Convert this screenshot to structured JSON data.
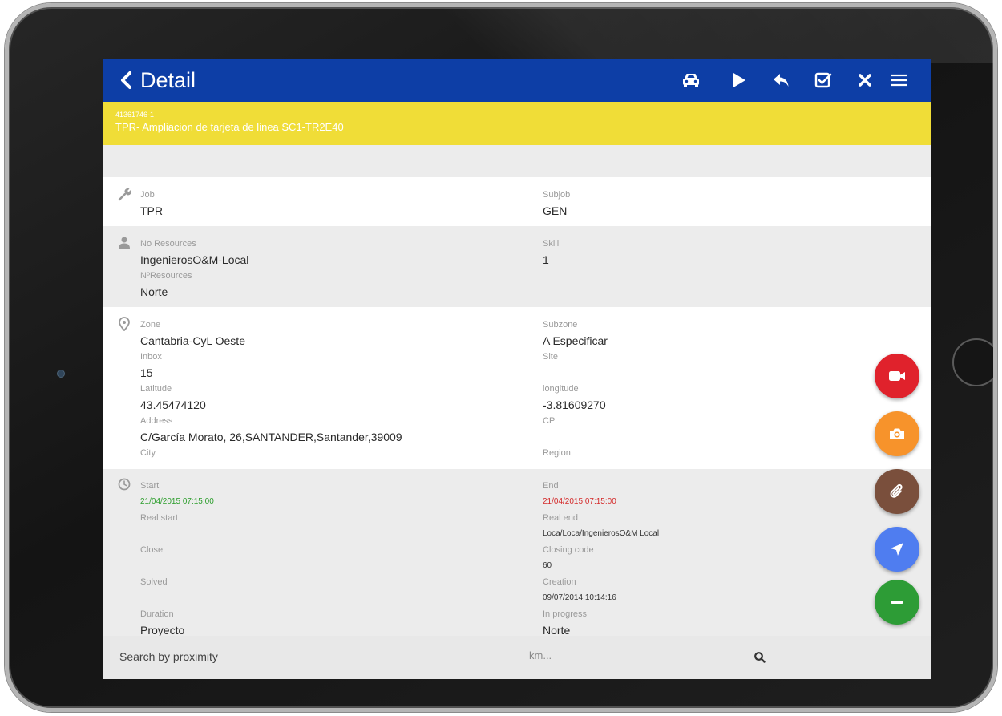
{
  "header": {
    "title": "Detail"
  },
  "banner": {
    "code": "41361746-1",
    "title": "TPR- Ampliacion de tarjeta de linea SC1-TR2E40"
  },
  "job_section": {
    "job_label": "Job",
    "job_value": "TPR",
    "subjob_label": "Subjob",
    "subjob_value": "GEN"
  },
  "resources_section": {
    "no_resources_label": "No Resources",
    "no_resources_value": "IngenierosO&M-Local",
    "n_resources_label": "NºResources",
    "n_resources_value": "Norte",
    "skill_label": "Skill",
    "skill_value": "1"
  },
  "location_section": {
    "zone_label": "Zone",
    "zone_value": "Cantabria-CyL Oeste",
    "subzone_label": "Subzone",
    "subzone_value": "A Especificar",
    "inbox_label": "Inbox",
    "inbox_value": "15",
    "site_label": "Site",
    "latitude_label": "Latitude",
    "latitude_value": "43.45474120",
    "longitude_label": "longitude",
    "longitude_value": "-3.81609270",
    "address_label": "Address",
    "address_value": "C/García Morato, 26,SANTANDER,Santander,39009",
    "cp_label": "CP",
    "city_label": "City",
    "region_label": "Region"
  },
  "time_section": {
    "start_label": "Start",
    "start_value": "21/04/2015 07:15:00",
    "end_label": "End",
    "end_value": "21/04/2015 07:15:00",
    "real_start_label": "Real start",
    "real_end_label": "Real end",
    "real_end_value": "Loca/Loca/IngenierosO&M Local",
    "close_label": "Close",
    "closing_code_label": "Closing code",
    "closing_code_value": "60",
    "solved_label": "Solved",
    "creation_label": "Creation",
    "creation_value": "09/07/2014 10:14:16",
    "duration_label": "Duration",
    "duration_value": "Proyecto",
    "in_progress_label": "In progress",
    "in_progress_value": "Norte"
  },
  "search": {
    "label": "Search by proximity",
    "placeholder": "km..."
  },
  "colors": {
    "app_bar": "#0d3ea6",
    "banner": "#f0dd37",
    "fab_video": "#e0222c",
    "fab_camera": "#f7932b",
    "fab_attach": "#7a4f3c",
    "fab_navigate": "#4f7df0",
    "fab_remove": "#2d9c36",
    "start_date": "#2b9d2b",
    "end_date": "#d42a2a"
  },
  "icons": {
    "toolbar": [
      "car-icon",
      "play-icon",
      "reply-icon",
      "check-square-icon",
      "close-icon",
      "menu-icon"
    ],
    "sections": [
      "wrench-icon",
      "person-icon",
      "location-pin-icon",
      "clock-icon"
    ],
    "fabs": [
      "video-camera-icon",
      "camera-icon",
      "paperclip-icon",
      "navigation-arrow-icon",
      "minus-icon"
    ],
    "search": "search-icon"
  }
}
